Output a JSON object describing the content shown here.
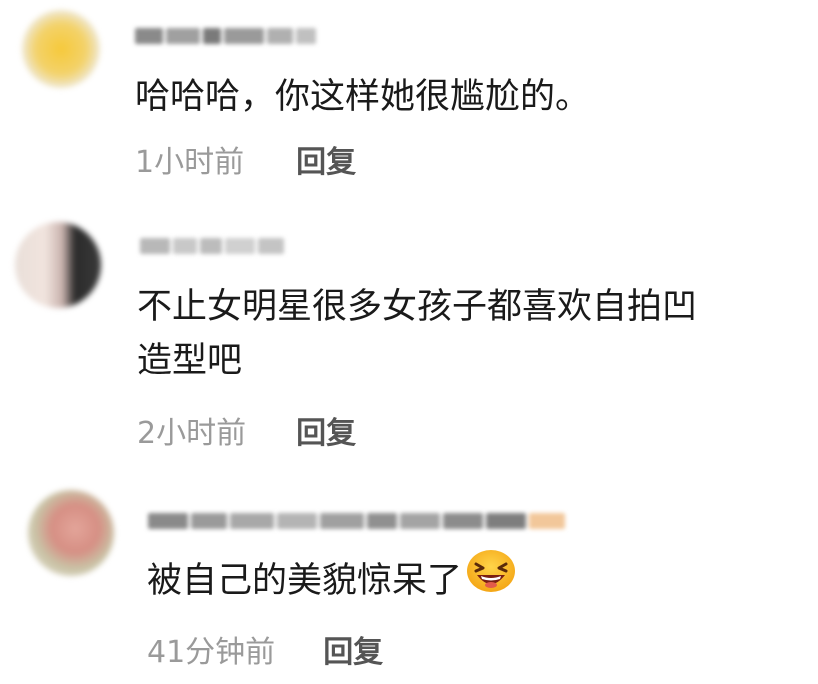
{
  "comments": [
    {
      "body": "哈哈哈，你这样她很尴尬的。",
      "time": "1小时前",
      "reply_label": "回复"
    },
    {
      "body_line1": "不止女明星很多女孩子都喜欢自拍凹",
      "body_line2": "造型吧",
      "time": "2小时前",
      "reply_label": "回复"
    },
    {
      "body": "被自己的美貌惊呆了",
      "emoji": "laughing-face-icon",
      "time": "41分钟前",
      "reply_label": "回复"
    }
  ],
  "colors": {
    "timestamp": "#9a9a9a",
    "reply": "#555555",
    "body": "#1a1a1a"
  }
}
